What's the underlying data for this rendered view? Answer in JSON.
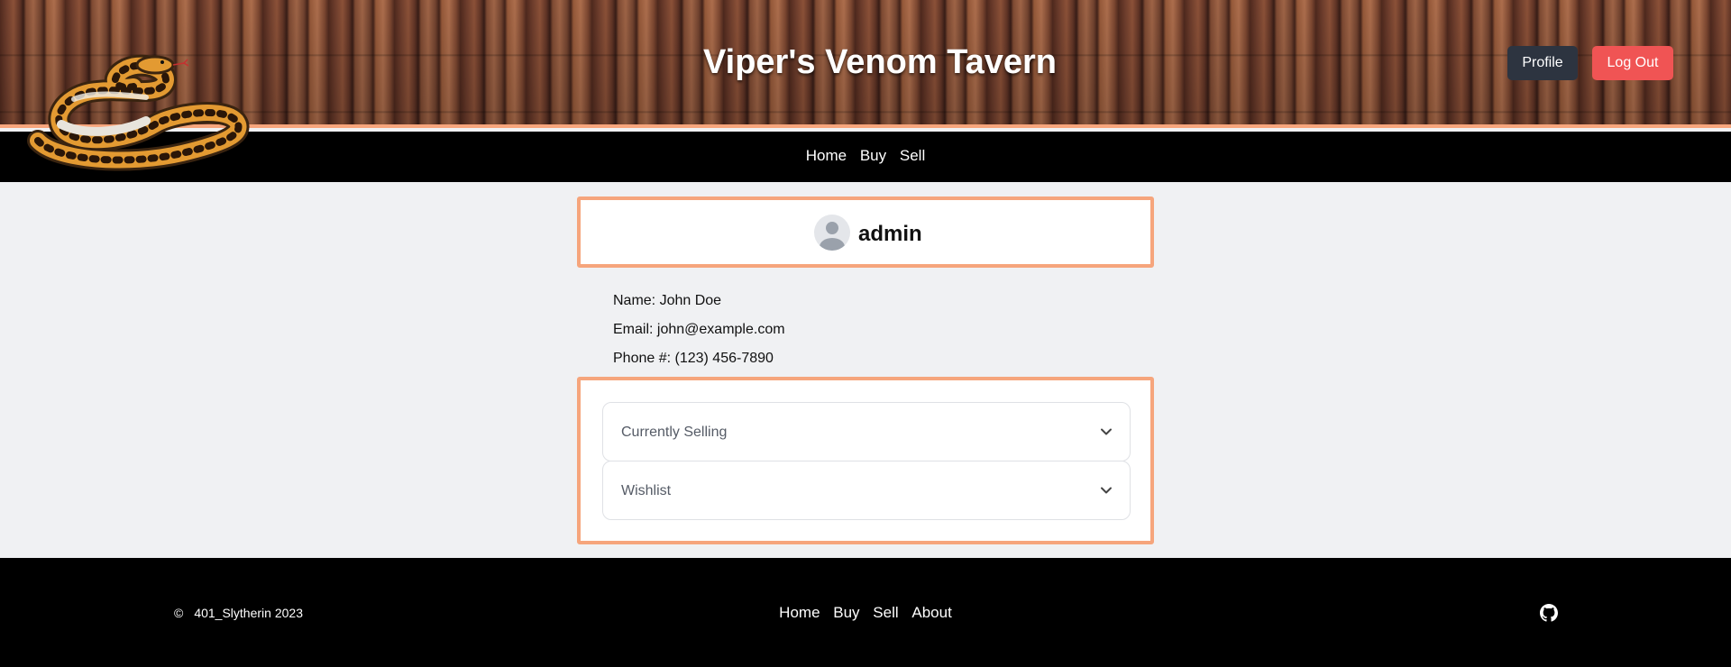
{
  "header": {
    "title": "Viper's Venom Tavern",
    "profile_label": "Profile",
    "logout_label": "Log Out"
  },
  "nav": {
    "items": [
      {
        "label": "Home"
      },
      {
        "label": "Buy"
      },
      {
        "label": "Sell"
      }
    ]
  },
  "profile": {
    "username": "admin",
    "name_line": "Name: John Doe",
    "email_line": "Email: john@example.com",
    "phone_line": "Phone #: (123) 456-7890"
  },
  "accordion": {
    "items": [
      {
        "label": "Currently Selling"
      },
      {
        "label": "Wishlist"
      }
    ]
  },
  "footer": {
    "copyright_symbol": "©",
    "copyright_text": "401_Slytherin 2023",
    "links": [
      {
        "label": "Home"
      },
      {
        "label": "Buy"
      },
      {
        "label": "Sell"
      },
      {
        "label": "About"
      }
    ],
    "github_icon": "github-icon"
  },
  "colors": {
    "accent_border": "#f6a57c",
    "profile_button": "#2d3440",
    "logout_button": "#f05454",
    "nav_background": "#000000",
    "page_background": "#f0f1f3"
  }
}
